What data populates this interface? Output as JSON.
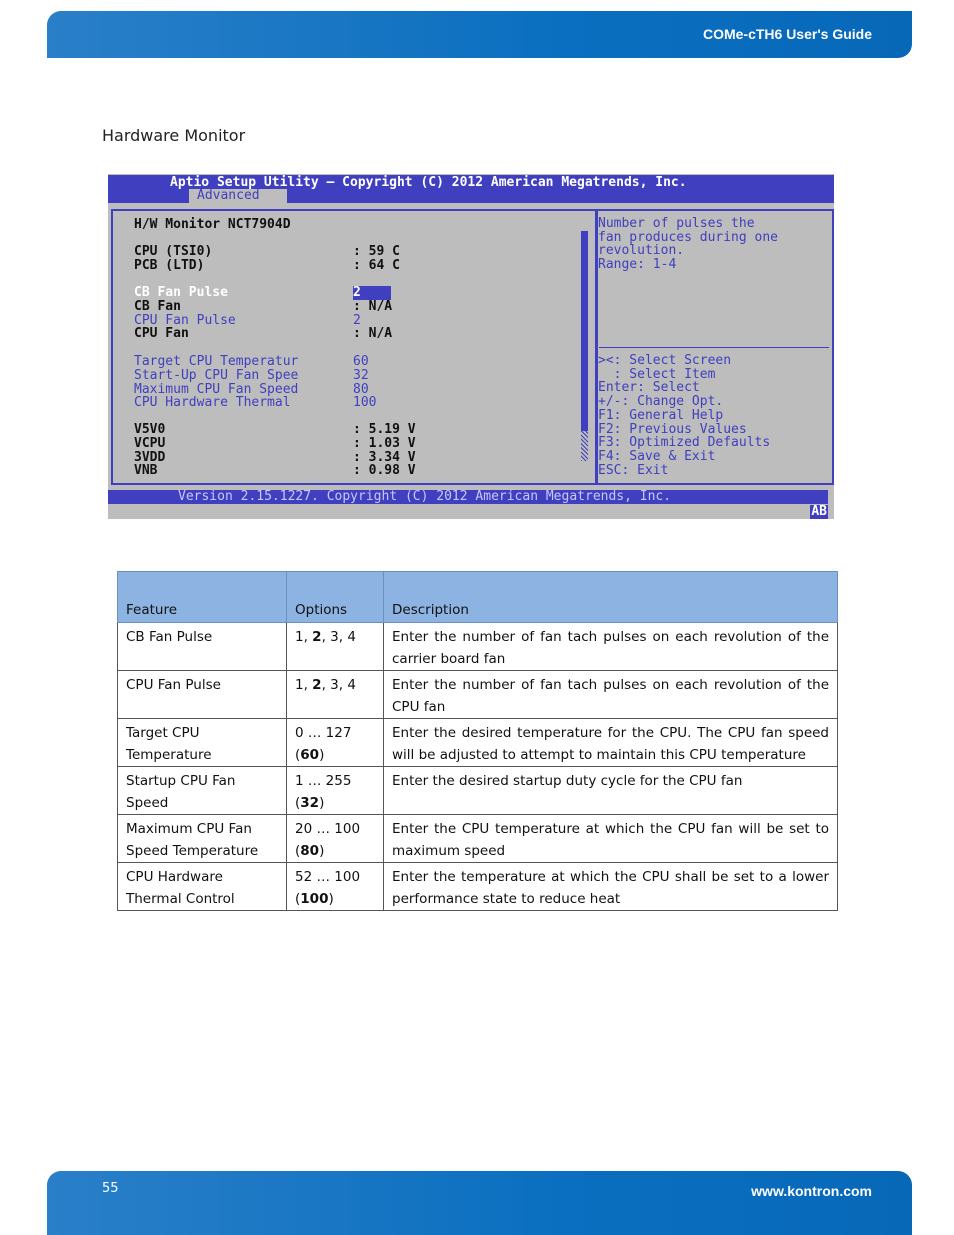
{
  "header": {
    "title": "COMe-cTH6 User's Guide"
  },
  "section_title": "Hardware Monitor",
  "bios": {
    "title": "Aptio Setup Utility – Copyright (C) 2012 American Megatrends, Inc.",
    "tab": "Advanced",
    "heading": "H/W Monitor NCT7904D",
    "rows": [
      {
        "label": "CPU (TSI0)",
        "value": ": 59 C",
        "style": "static"
      },
      {
        "label": "PCB (LTD)",
        "value": ": 64 C",
        "style": "static"
      },
      {
        "label": "CB Fan Pulse",
        "value": "2",
        "style": "selected"
      },
      {
        "label": "CB Fan",
        "value": ": N/A",
        "style": "static"
      },
      {
        "label": "CPU Fan Pulse",
        "value": "2",
        "style": "option"
      },
      {
        "label": "CPU Fan",
        "value": ": N/A",
        "style": "static"
      },
      {
        "label": "Target CPU Temperatur",
        "value": "60",
        "style": "option"
      },
      {
        "label": "Start-Up CPU Fan Spee",
        "value": "32",
        "style": "option"
      },
      {
        "label": "Maximum CPU Fan Speed",
        "value": "80",
        "style": "option"
      },
      {
        "label": "CPU Hardware Thermal",
        "value": "100",
        "style": "option"
      },
      {
        "label": "V5V0",
        "value": ": 5.19 V",
        "style": "static"
      },
      {
        "label": "VCPU",
        "value": ": 1.03 V",
        "style": "static"
      },
      {
        "label": "3VDD",
        "value": ": 3.34 V",
        "style": "static"
      },
      {
        "label": "VNB",
        "value": ": 0.98 V",
        "style": "static"
      }
    ],
    "help": [
      "Number of pulses the",
      "fan produces during one",
      "revolution.",
      "Range: 1-4"
    ],
    "keys": [
      "><: Select Screen",
      "  : Select Item",
      "Enter: Select",
      "+/-: Change Opt.",
      "F1: General Help",
      "F2: Previous Values",
      "F3: Optimized Defaults",
      "F4: Save & Exit",
      "ESC: Exit"
    ],
    "version": "Version 2.15.1227. Copyright (C) 2012 American Megatrends, Inc.",
    "badge": "AB",
    "colors": {
      "blue": "#3f3fbf",
      "background": "#bdbdbd"
    }
  },
  "table": {
    "headers": [
      "Feature",
      "Options",
      "Description"
    ],
    "rows": [
      {
        "feature": "CB Fan Pulse",
        "opt_pre": "1, ",
        "opt_bold": "2",
        "opt_post": ", 3, 4",
        "desc": "Enter the number of fan tach pulses on each revolution of the carrier board fan"
      },
      {
        "feature": "CPU Fan Pulse",
        "opt_pre": "1, ",
        "opt_bold": "2",
        "opt_post": ", 3, 4",
        "desc": "Enter the number of fan tach pulses on each revolution of the CPU fan"
      },
      {
        "feature": "Target CPU Temperature",
        "opt_pre": "0 … 127 (",
        "opt_bold": "60",
        "opt_post": ")",
        "desc": "Enter the desired temperature for the CPU.  The CPU fan speed will be adjusted to attempt to maintain this CPU temperature"
      },
      {
        "feature": "Startup CPU Fan Speed",
        "opt_pre": "1 … 255 (",
        "opt_bold": "32",
        "opt_post": ")",
        "desc": "Enter the desired startup duty cycle for the CPU fan"
      },
      {
        "feature": "Maximum CPU Fan Speed Temperature",
        "opt_pre": "20 … 100 (",
        "opt_bold": "80",
        "opt_post": ")",
        "desc": "Enter the CPU temperature at which the CPU fan will be set to maximum speed"
      },
      {
        "feature": "CPU Hardware Thermal Control",
        "opt_pre": "52 … 100 (",
        "opt_bold": "100",
        "opt_post": ")",
        "desc": "Enter the temperature at which the CPU shall be set to a lower performance state to reduce heat"
      }
    ]
  },
  "footer": {
    "page": "55",
    "url": "www.kontron.com"
  }
}
